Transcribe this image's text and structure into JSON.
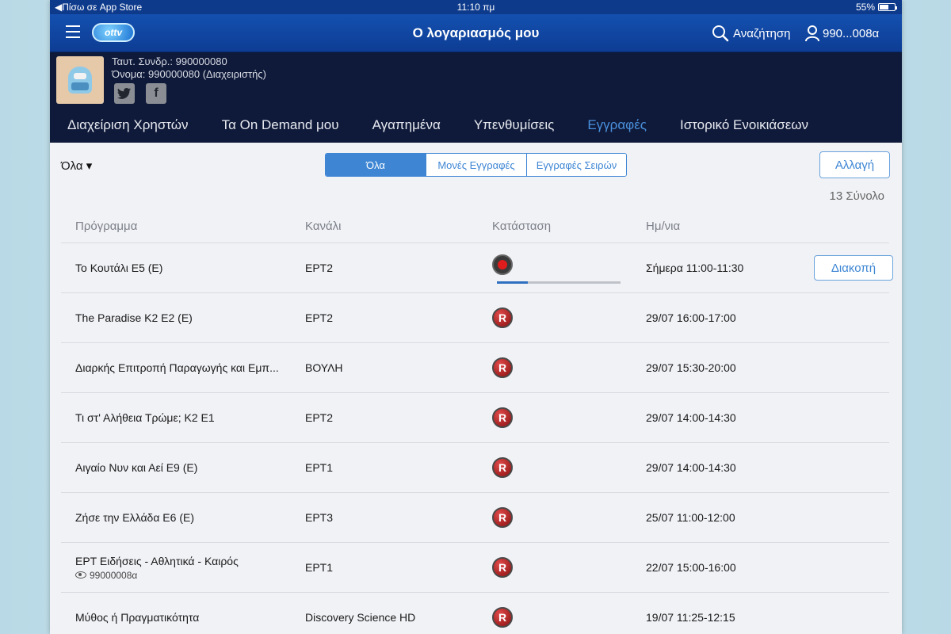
{
  "status_bar": {
    "back": "◀︎Πίσω σε App Store",
    "time": "11:10 πμ",
    "battery": "55%"
  },
  "nav": {
    "logo": "ottv",
    "title": "Ο λογαριασμός μου",
    "search_label": "Αναζήτηση",
    "user_label": "990...008α"
  },
  "profile": {
    "subscriber_line": "Ταυτ. Συνδρ.: 990000080",
    "name_line": "Όνομα: 990000080 (Διαχειριστής)",
    "twitter": "t",
    "facebook": "f"
  },
  "tabs": [
    {
      "label": "Διαχείριση Χρηστών"
    },
    {
      "label": "Τα On Demand μου"
    },
    {
      "label": "Αγαπημένα"
    },
    {
      "label": "Υπενθυμίσεις"
    },
    {
      "label": "Εγγραφές"
    },
    {
      "label": "Ιστορικό Ενοικιάσεων"
    }
  ],
  "toolbar": {
    "filter_label": "Όλα ▾",
    "segments": [
      "Όλα",
      "Μονές Εγγραφές",
      "Εγγραφές Σειρών"
    ],
    "change_label": "Αλλαγή",
    "total_label": "13 Σύνολο"
  },
  "table": {
    "headers": [
      "Πρόγραμμα",
      "Κανάλι",
      "Κατάσταση",
      "Ημ/νια"
    ],
    "stop_label": "Διακοπή",
    "r_label": "R",
    "rows": [
      {
        "program": "Το Κουτάλι Ε5 (Ε)",
        "channel": "ΕΡΤ2",
        "status": "recording",
        "progress": 0.25,
        "date": "Σήμερα 11:00-11:30"
      },
      {
        "program": "The Paradise K2 E2 (E)",
        "channel": "ΕΡΤ2",
        "status": "scheduled",
        "date": "29/07 16:00-17:00"
      },
      {
        "program": "Διαρκής Επιτροπή Παραγωγής και Εμπ...",
        "channel": "ΒΟΥΛΗ",
        "status": "scheduled",
        "date": "29/07 15:30-20:00"
      },
      {
        "program": "Τι στ' Αλήθεια Τρώμε; Κ2 Ε1",
        "channel": "ΕΡΤ2",
        "status": "scheduled",
        "date": "29/07 14:00-14:30"
      },
      {
        "program": "Αιγαίο Νυν και Αεί Ε9 (Ε)",
        "channel": "ΕΡΤ1",
        "status": "scheduled",
        "date": "29/07 14:00-14:30"
      },
      {
        "program": "Ζήσε την Ελλάδα Ε6 (Ε)",
        "channel": "ΕΡΤ3",
        "status": "scheduled",
        "date": "25/07 11:00-12:00"
      },
      {
        "program": "ΕΡΤ Ειδήσεις - Αθλητικά - Καιρός",
        "channel": "ΕΡΤ1",
        "status": "scheduled",
        "date": "22/07 15:00-16:00",
        "viewer": "99000008α"
      },
      {
        "program": "Μύθος ή Πραγματικότητα",
        "channel": "Discovery Science HD",
        "status": "scheduled",
        "date": "19/07 11:25-12:15"
      }
    ]
  }
}
